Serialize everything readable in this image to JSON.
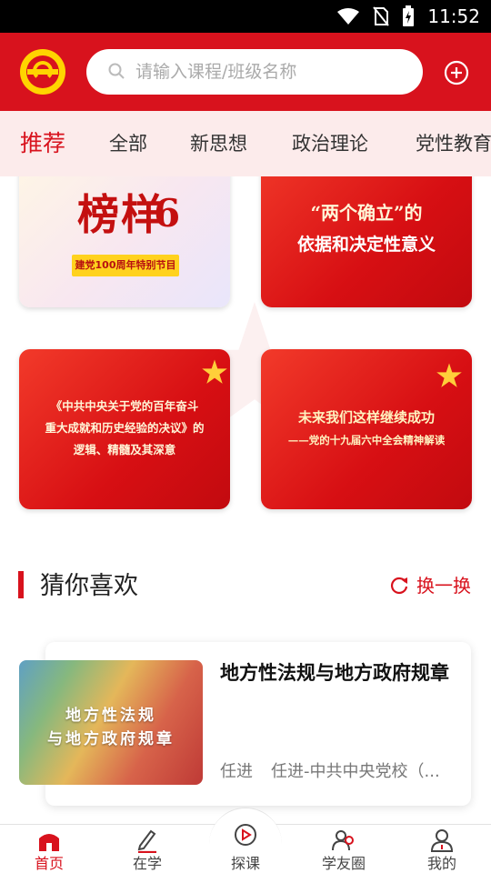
{
  "status_bar": {
    "time": "11:52",
    "icons": [
      "wifi-icon",
      "no-sim-icon",
      "battery-charging-icon"
    ]
  },
  "header": {
    "logo": "party-school-logo",
    "search_placeholder": "请输入课程/班级名称",
    "add_icon": "plus-circle-icon"
  },
  "tabs": [
    {
      "label": "推荐",
      "active": true
    },
    {
      "label": "全部",
      "active": false
    },
    {
      "label": "新思想",
      "active": false
    },
    {
      "label": "政治理论",
      "active": false
    },
    {
      "label": "党性教育",
      "active": false
    }
  ],
  "featured": {
    "card1": {
      "main": "榜样",
      "num": "6",
      "sub": "建党100周年特别节目"
    },
    "card2": {
      "line1": "“两个确立”的",
      "line2": "依据和决定性意义"
    },
    "card3": {
      "line1": "《中共中央关于党的百年奋斗",
      "line2": "重大成就和历史经验的决议》的",
      "line3": "逻辑、精髓及其深意"
    },
    "card4": {
      "line1": "未来我们这样继续成功",
      "line2": "——党的十九届六中全会精神解读"
    }
  },
  "section": {
    "title": "猜你喜欢",
    "refresh_label": "换一换"
  },
  "recommend": {
    "thumb_line1": "地方性法规",
    "thumb_line2": "与地方政府规章",
    "title": "地方性法规与地方政府规章",
    "author": "任进",
    "source": "任进-中共中央党校（..."
  },
  "bottom_nav": [
    {
      "label": "首页",
      "icon": "home-icon",
      "active": true
    },
    {
      "label": "在学",
      "icon": "pencil-icon",
      "active": false
    },
    {
      "label": "探课",
      "icon": "play-circle-icon",
      "active": false
    },
    {
      "label": "学友圈",
      "icon": "friends-icon",
      "active": false
    },
    {
      "label": "我的",
      "icon": "user-icon",
      "active": false
    }
  ],
  "colors": {
    "brand_red": "#d8121d",
    "tab_bg": "#fcebeb",
    "logo_yellow": "#ffd400"
  }
}
